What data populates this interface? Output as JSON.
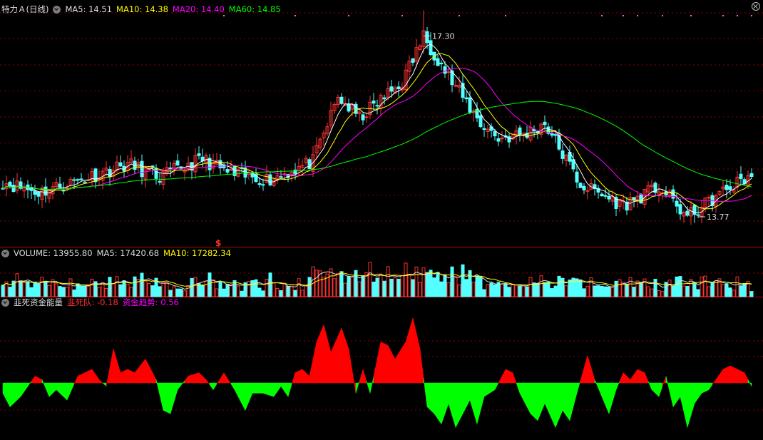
{
  "price_header": {
    "title": "特力Ａ(日线)",
    "ma5": "MA5: 14.51",
    "ma10": "MA10: 14.38",
    "ma20": "MA20: 14.40",
    "ma60": "MA60: 14.85"
  },
  "volume_header": {
    "label": "VOLUME: 13955.80",
    "ma5": "MA5: 17420.68",
    "ma10": "MA10: 17282.34"
  },
  "indicator_header": {
    "title": "韭死资金能量",
    "dead": "韭死队: -0.18",
    "trend": "资金趋势: 0.56"
  },
  "annotations": {
    "high": "17.30",
    "low": "13.77",
    "marker": "$"
  },
  "colors": {
    "up": "#ff3232",
    "down": "#54ffff",
    "ma5": "#ffffff",
    "ma10": "#ffff00",
    "ma20": "#ff00ff",
    "ma60": "#00ff00",
    "grid": "#8b0000",
    "ind_pos": "#ff0000",
    "ind_neg": "#00ff00"
  },
  "chart_data": {
    "type": "candlestick",
    "ylim_price": [
      13.2,
      17.75
    ],
    "high_value": 17.3,
    "low_value": 13.77,
    "cycles": [
      [
        0,
        14.45
      ],
      [
        10,
        14.25
      ],
      [
        22,
        14.5
      ],
      [
        35,
        14.8
      ],
      [
        44,
        14.55
      ],
      [
        56,
        14.9
      ],
      [
        64,
        14.6
      ],
      [
        75,
        14.5
      ],
      [
        87,
        14.85
      ],
      [
        94,
        16.1
      ],
      [
        100,
        15.7
      ],
      [
        112,
        16.4
      ],
      [
        118,
        17.3
      ],
      [
        126,
        16.4
      ],
      [
        134,
        15.6
      ],
      [
        139,
        15.3
      ],
      [
        147,
        15.4
      ],
      [
        152,
        15.6
      ],
      [
        162,
        14.4
      ],
      [
        174,
        14.0
      ],
      [
        184,
        14.35
      ],
      [
        192,
        13.77
      ],
      [
        203,
        14.3
      ],
      [
        210,
        14.6
      ]
    ],
    "indicator": {
      "values": [
        [
          0,
          -0.3
        ],
        [
          2,
          -0.7
        ],
        [
          5,
          -0.4
        ],
        [
          7,
          -0.1
        ],
        [
          9,
          0.2
        ],
        [
          11,
          0.1
        ],
        [
          13,
          -0.4
        ],
        [
          15,
          -0.2
        ],
        [
          18,
          -0.5
        ],
        [
          21,
          0.2
        ],
        [
          25,
          0.4
        ],
        [
          27,
          0.1
        ],
        [
          29,
          -0.1
        ],
        [
          31,
          1.0
        ],
        [
          33,
          0.3
        ],
        [
          35,
          0.4
        ],
        [
          37,
          0.3
        ],
        [
          40,
          0.7
        ],
        [
          43,
          0.1
        ],
        [
          45,
          -0.8
        ],
        [
          47,
          -0.9
        ],
        [
          49,
          -0.2
        ],
        [
          52,
          0.2
        ],
        [
          55,
          0.3
        ],
        [
          57,
          0.1
        ],
        [
          59,
          -0.2
        ],
        [
          62,
          0.3
        ],
        [
          65,
          -0.2
        ],
        [
          68,
          -0.8
        ],
        [
          70,
          -0.3
        ],
        [
          73,
          -0.3
        ],
        [
          76,
          -0.4
        ],
        [
          78,
          -0.1
        ],
        [
          80,
          -0.4
        ],
        [
          82,
          0.3
        ],
        [
          84,
          0.4
        ],
        [
          86,
          0.2
        ],
        [
          88,
          1.2
        ],
        [
          90,
          1.7
        ],
        [
          92,
          0.9
        ],
        [
          95,
          1.6
        ],
        [
          97,
          1.0
        ],
        [
          99,
          -0.3
        ],
        [
          101,
          0.4
        ],
        [
          103,
          -0.3
        ],
        [
          106,
          1.2
        ],
        [
          108,
          1.1
        ],
        [
          110,
          0.7
        ],
        [
          113,
          1.2
        ],
        [
          115,
          1.9
        ],
        [
          117,
          1.0
        ],
        [
          119,
          -0.7
        ],
        [
          121,
          -0.9
        ],
        [
          123,
          -1.2
        ],
        [
          125,
          -0.6
        ],
        [
          127,
          -1.3
        ],
        [
          129,
          -0.9
        ],
        [
          131,
          -0.5
        ],
        [
          133,
          -1.2
        ],
        [
          135,
          -0.4
        ],
        [
          138,
          -0.2
        ],
        [
          141,
          0.4
        ],
        [
          143,
          0.3
        ],
        [
          145,
          -0.3
        ],
        [
          148,
          -0.9
        ],
        [
          150,
          -1.1
        ],
        [
          152,
          -0.6
        ],
        [
          155,
          -1.3
        ],
        [
          157,
          -0.8
        ],
        [
          159,
          -1.1
        ],
        [
          161,
          -0.3
        ],
        [
          164,
          0.8
        ],
        [
          166,
          0.1
        ],
        [
          168,
          -0.4
        ],
        [
          170,
          -0.9
        ],
        [
          172,
          -0.2
        ],
        [
          174,
          0.3
        ],
        [
          176,
          0.1
        ],
        [
          178,
          0.4
        ],
        [
          180,
          0.3
        ],
        [
          182,
          -0.2
        ],
        [
          184,
          -0.4
        ],
        [
          186,
          0.2
        ],
        [
          188,
          -0.7
        ],
        [
          190,
          -0.4
        ],
        [
          192,
          -1.3
        ],
        [
          194,
          -0.6
        ],
        [
          196,
          -0.3
        ],
        [
          198,
          -0.2
        ],
        [
          200,
          0.1
        ],
        [
          202,
          0.4
        ],
        [
          204,
          0.5
        ],
        [
          206,
          0.4
        ],
        [
          208,
          0.3
        ],
        [
          210,
          -0.1
        ]
      ]
    }
  }
}
